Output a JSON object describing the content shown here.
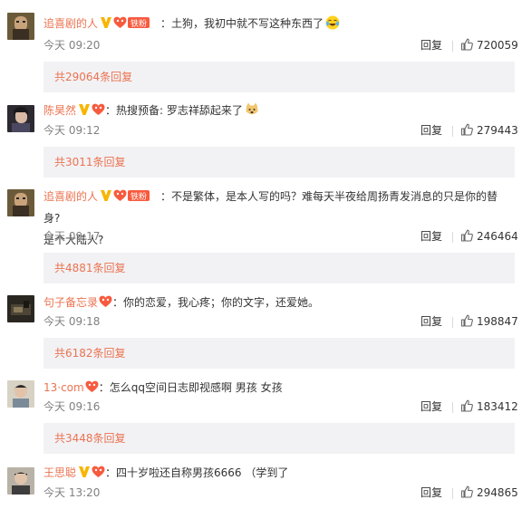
{
  "comments": [
    {
      "username": "追喜剧的人",
      "badges": [
        "vip-v-icon",
        "heart-icon",
        "fan-badge-icon"
      ],
      "fan_badge_text": "铁粉",
      "text": "：土狗，我初中就不写这种东西了",
      "text2": "",
      "emoji": "laughing-tears-emoji",
      "time": "今天 09:20",
      "reply_label": "回复",
      "likes": "720059",
      "replies_label": "共29064条回复"
    },
    {
      "username": "陈昊然",
      "badges": [
        "vip-v-icon",
        "heart-icon"
      ],
      "fan_badge_text": "",
      "text": "：热搜预备: 罗志祥舔起来了",
      "text2": "",
      "emoji": "doge-emoji",
      "time": "今天 09:12",
      "reply_label": "回复",
      "likes": "279443",
      "replies_label": "共3011条回复"
    },
    {
      "username": "追喜剧的人",
      "badges": [
        "vip-v-icon",
        "heart-icon",
        "fan-badge-icon"
      ],
      "fan_badge_text": "铁粉",
      "text": "：不是繁体，是本人写的吗？难每天半夜给周扬青发消息的只是你的替身?",
      "text2": "是个大陆人?",
      "emoji": "",
      "time": "今天 09:17",
      "reply_label": "回复",
      "likes": "246464",
      "replies_label": "共4881条回复"
    },
    {
      "username": "句子备忘录",
      "badges": [
        "heart-icon"
      ],
      "fan_badge_text": "",
      "text": "：你的恋爱，我心疼；你的文字，还爱她。",
      "text2": "",
      "emoji": "",
      "time": "今天 09:18",
      "reply_label": "回复",
      "likes": "198847",
      "replies_label": "共6182条回复"
    },
    {
      "username": "13·com",
      "badges": [
        "heart-icon"
      ],
      "fan_badge_text": "",
      "text": "：怎么qq空间日志即视感啊  男孩 女孩",
      "text2": "",
      "emoji": "",
      "time": "今天 09:16",
      "reply_label": "回复",
      "likes": "183412",
      "replies_label": "共3448条回复"
    },
    {
      "username": "王思聪",
      "badges": [
        "vip-v-icon",
        "heart-icon"
      ],
      "fan_badge_text": "",
      "text": "：四十岁啦还自称男孩6666 （学到了",
      "text2": "",
      "emoji": "",
      "time": "今天 13:20",
      "reply_label": "回复",
      "likes": "294865",
      "replies_label": ""
    }
  ]
}
